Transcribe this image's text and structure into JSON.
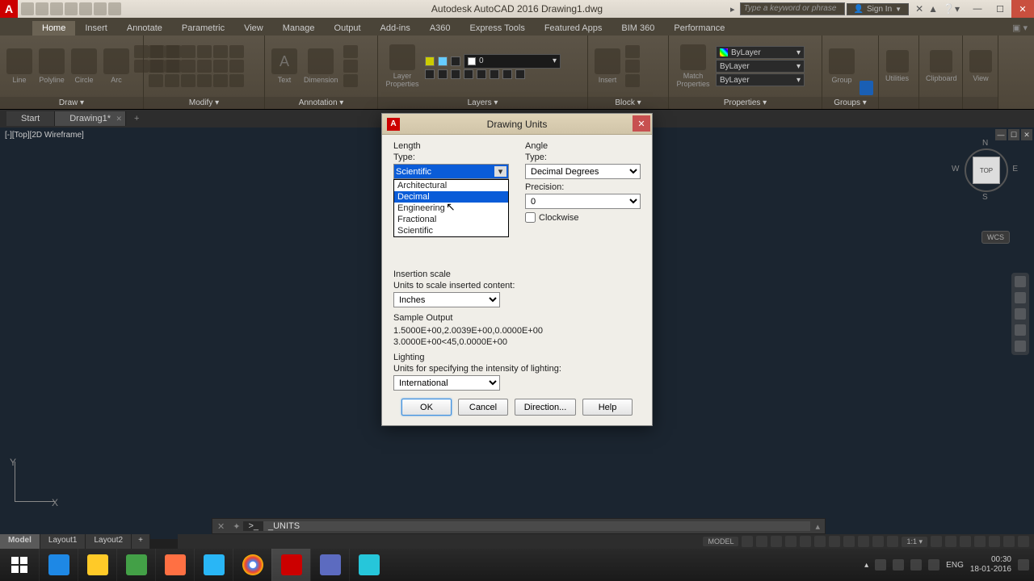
{
  "title": "Autodesk AutoCAD 2016   Drawing1.dwg",
  "search_placeholder": "Type a keyword or phrase",
  "signin": "Sign In",
  "ribbon_tabs": [
    "Home",
    "Insert",
    "Annotate",
    "Parametric",
    "View",
    "Manage",
    "Output",
    "Add-ins",
    "A360",
    "Express Tools",
    "Featured Apps",
    "BIM 360",
    "Performance"
  ],
  "panels": {
    "draw": "Draw ▾",
    "modify": "Modify ▾",
    "annotation": "Annotation ▾",
    "layers": "Layers ▾",
    "block": "Block ▾",
    "properties": "Properties ▾",
    "groups": "Groups ▾",
    "utilities": "Utilities",
    "clipboard": "Clipboard",
    "view": "View"
  },
  "draw_tools": {
    "line": "Line",
    "polyline": "Polyline",
    "circle": "Circle",
    "arc": "Arc"
  },
  "anno_tools": {
    "text": "Text",
    "dim": "Dimension"
  },
  "layer_tools": {
    "props": "Layer Properties"
  },
  "layer_current": "0",
  "block_tools": {
    "insert": "Insert",
    "match": "Match Properties"
  },
  "prop_rows": {
    "color": "ByLayer",
    "line": "ByLayer",
    "lw": "ByLayer"
  },
  "groups_tool": "Group",
  "doctabs": {
    "start": "Start",
    "drawing": "Drawing1*"
  },
  "viewport": "[-][Top][2D Wireframe]",
  "viewcube": {
    "top": "TOP",
    "n": "N",
    "s": "S",
    "e": "E",
    "w": "W",
    "wcs": "WCS"
  },
  "cmd": {
    "prompt": ">_",
    "text": "_UNITS"
  },
  "modeltabs": {
    "model": "Model",
    "l1": "Layout1",
    "l2": "Layout2"
  },
  "status": {
    "model": "MODEL",
    "scale": "1:1 ▾"
  },
  "dialog": {
    "title": "Drawing Units",
    "length": "Length",
    "angle": "Angle",
    "type": "Type:",
    "precision": "Precision:",
    "length_sel": "Scientific",
    "angle_sel": "Decimal Degrees",
    "precision_sel": "0",
    "opts": [
      "Architectural",
      "Decimal",
      "Engineering",
      "Fractional",
      "Scientific"
    ],
    "clockwise": "Clockwise",
    "ins_scale": "Insertion scale",
    "ins_label": "Units to scale inserted content:",
    "ins_sel": "Inches",
    "sample": "Sample Output",
    "sample1": "1.5000E+00,2.0039E+00,0.0000E+00",
    "sample2": "3.0000E+00<45,0.0000E+00",
    "lighting": "Lighting",
    "lighting_label": "Units for specifying the intensity of lighting:",
    "lighting_sel": "International",
    "ok": "OK",
    "cancel": "Cancel",
    "direction": "Direction...",
    "help": "Help"
  },
  "tray": {
    "lang": "ENG",
    "time": "00:30",
    "date": "18-01-2016"
  }
}
